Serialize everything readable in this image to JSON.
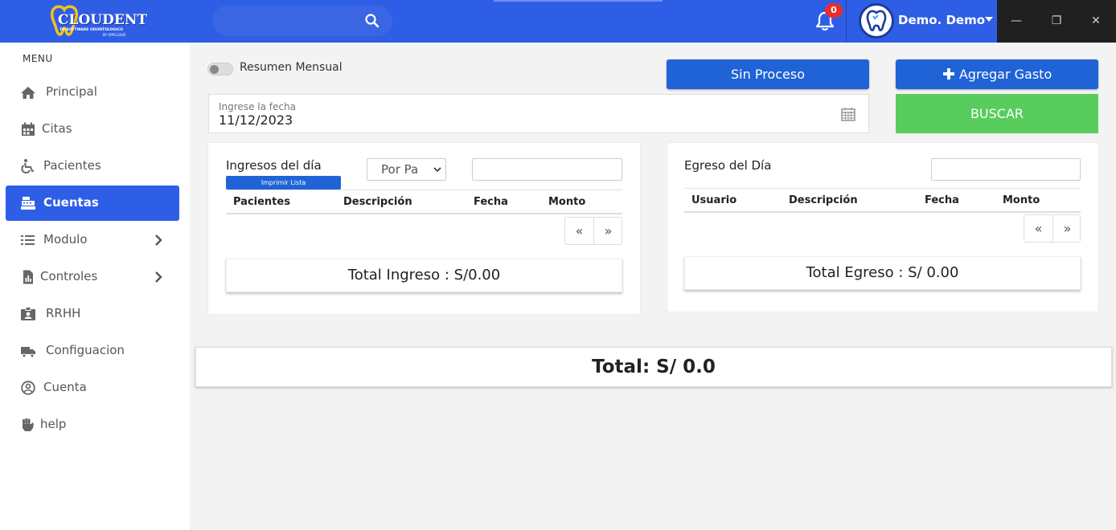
{
  "header": {
    "logo_text": "CLOUDENT",
    "logo_tagline": "TU SOFTWARE ODONTOLOGICO",
    "logo_byline": "BY OPPCLOUD",
    "search_placeholder": "",
    "notifications_count": "0",
    "user_name": "Demo. Demo",
    "window_minimize": "—",
    "window_restore": "❐",
    "window_close": "✕"
  },
  "sidebar": {
    "title": "MENU",
    "items": [
      {
        "label": "Principal",
        "icon": "home-icon"
      },
      {
        "label": "Citas",
        "icon": "calendar-icon"
      },
      {
        "label": "Pacientes",
        "icon": "wheelchair-icon"
      },
      {
        "label": "Cuentas",
        "icon": "cash-register-icon",
        "active": true
      },
      {
        "label": "Modulo",
        "icon": "list-icon",
        "submenu": true
      },
      {
        "label": "Controles",
        "icon": "file-chart-icon",
        "submenu": true
      },
      {
        "label": "RRHH",
        "icon": "id-badge-icon"
      },
      {
        "label": "Configuacion",
        "icon": "truck-settings-icon"
      },
      {
        "label": "Cuenta",
        "icon": "user-circle-icon"
      },
      {
        "label": "help",
        "icon": "fist-icon"
      }
    ]
  },
  "filters": {
    "toggle_label": "Resumen Mensual",
    "toggle_on": false,
    "status_button": "Sin Proceso",
    "add_expense_button": "Agregar Gasto",
    "search_button": "BUSCAR",
    "date_label": "Ingrese la fecha",
    "date_value": "11/12/2023"
  },
  "income": {
    "title": "Ingresos del día",
    "print_button": "Imprimir Lista",
    "select_value": "Por Pa",
    "columns": [
      "Pacientes",
      "Descripción",
      "Fecha",
      "Monto"
    ],
    "rows": [],
    "pager_prev": "«",
    "pager_next": "»",
    "total_text": "Total Ingreso : S/0.00"
  },
  "expense": {
    "title": "Egreso del Día",
    "columns": [
      "Usuario",
      "Descripción",
      "Fecha",
      "Monto"
    ],
    "rows": [],
    "pager_prev": "«",
    "pager_next": "»",
    "total_text": "Total Egreso : S/ 0.00"
  },
  "grand_total": "Total: S/ 0.0",
  "colors": {
    "primary": "#2e5ee6",
    "button_blue": "#1f63d6",
    "success": "#58cd5e",
    "badge_red": "#e82c2c"
  }
}
